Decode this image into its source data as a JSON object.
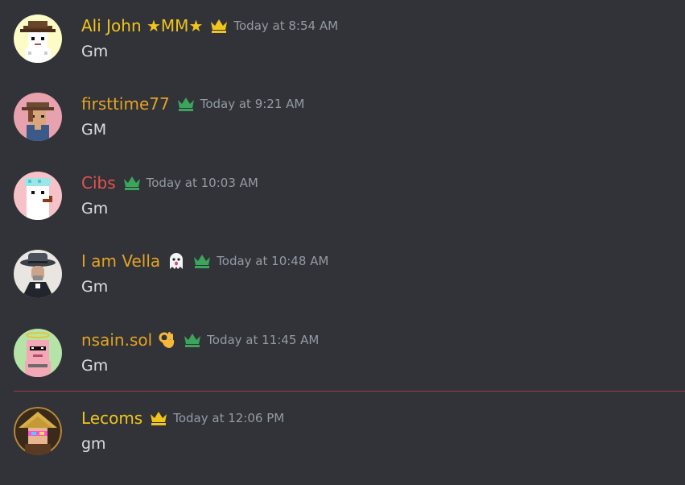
{
  "messages": [
    {
      "username": "Ali John ★MM★",
      "color": "#f0c41b",
      "badge": "gold-crown",
      "emoji": "",
      "timestamp": "Today at 8:54 AM",
      "text": "Gm"
    },
    {
      "username": "firsttime77",
      "color": "#e6a323",
      "badge": "green-crown",
      "emoji": "",
      "timestamp": "Today at 9:21 AM",
      "text": "GM"
    },
    {
      "username": "Cibs",
      "color": "#e8534f",
      "badge": "green-crown",
      "emoji": "",
      "timestamp": "Today at 10:03 AM",
      "text": "Gm"
    },
    {
      "username": "I am Vella",
      "color": "#e6a323",
      "badge": "green-crown",
      "emoji": "ghost",
      "timestamp": "Today at 10:48 AM",
      "text": "Gm"
    },
    {
      "username": "nsain.sol",
      "color": "#e6a323",
      "badge": "green-crown",
      "emoji": "ok-hand",
      "timestamp": "Today at 11:45 AM",
      "text": "Gm"
    },
    {
      "username": "Lecoms",
      "color": "#f0c41b",
      "badge": "gold-crown",
      "emoji": "",
      "timestamp": "Today at 12:06 PM",
      "text": "gm"
    }
  ],
  "colors": {
    "background": "#313338",
    "timestamp": "#949ba4",
    "text": "#dbdee1",
    "new_messages_divider": "#a13b3d",
    "gold_crown": "#f0c41b",
    "green_crown": "#3ba55c"
  }
}
